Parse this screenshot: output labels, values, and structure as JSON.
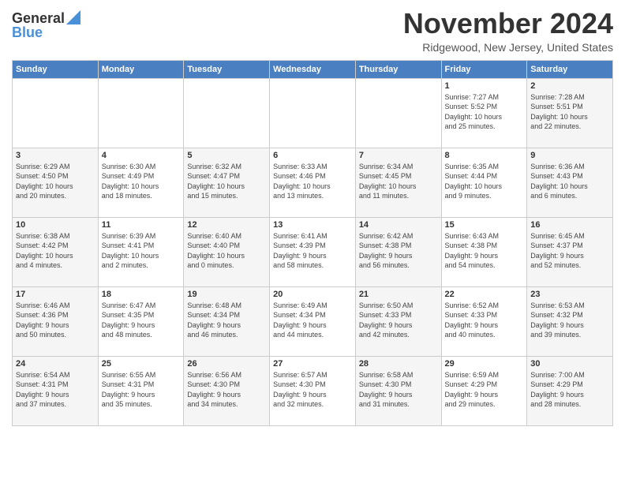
{
  "header": {
    "logo": {
      "line1": "General",
      "line2": "Blue"
    },
    "title": "November 2024",
    "subtitle": "Ridgewood, New Jersey, United States"
  },
  "weekdays": [
    "Sunday",
    "Monday",
    "Tuesday",
    "Wednesday",
    "Thursday",
    "Friday",
    "Saturday"
  ],
  "weeks": [
    [
      {
        "day": "",
        "info": ""
      },
      {
        "day": "",
        "info": ""
      },
      {
        "day": "",
        "info": ""
      },
      {
        "day": "",
        "info": ""
      },
      {
        "day": "",
        "info": ""
      },
      {
        "day": "1",
        "info": "Sunrise: 7:27 AM\nSunset: 5:52 PM\nDaylight: 10 hours\nand 25 minutes."
      },
      {
        "day": "2",
        "info": "Sunrise: 7:28 AM\nSunset: 5:51 PM\nDaylight: 10 hours\nand 22 minutes."
      }
    ],
    [
      {
        "day": "3",
        "info": "Sunrise: 6:29 AM\nSunset: 4:50 PM\nDaylight: 10 hours\nand 20 minutes."
      },
      {
        "day": "4",
        "info": "Sunrise: 6:30 AM\nSunset: 4:49 PM\nDaylight: 10 hours\nand 18 minutes."
      },
      {
        "day": "5",
        "info": "Sunrise: 6:32 AM\nSunset: 4:47 PM\nDaylight: 10 hours\nand 15 minutes."
      },
      {
        "day": "6",
        "info": "Sunrise: 6:33 AM\nSunset: 4:46 PM\nDaylight: 10 hours\nand 13 minutes."
      },
      {
        "day": "7",
        "info": "Sunrise: 6:34 AM\nSunset: 4:45 PM\nDaylight: 10 hours\nand 11 minutes."
      },
      {
        "day": "8",
        "info": "Sunrise: 6:35 AM\nSunset: 4:44 PM\nDaylight: 10 hours\nand 9 minutes."
      },
      {
        "day": "9",
        "info": "Sunrise: 6:36 AM\nSunset: 4:43 PM\nDaylight: 10 hours\nand 6 minutes."
      }
    ],
    [
      {
        "day": "10",
        "info": "Sunrise: 6:38 AM\nSunset: 4:42 PM\nDaylight: 10 hours\nand 4 minutes."
      },
      {
        "day": "11",
        "info": "Sunrise: 6:39 AM\nSunset: 4:41 PM\nDaylight: 10 hours\nand 2 minutes."
      },
      {
        "day": "12",
        "info": "Sunrise: 6:40 AM\nSunset: 4:40 PM\nDaylight: 10 hours\nand 0 minutes."
      },
      {
        "day": "13",
        "info": "Sunrise: 6:41 AM\nSunset: 4:39 PM\nDaylight: 9 hours\nand 58 minutes."
      },
      {
        "day": "14",
        "info": "Sunrise: 6:42 AM\nSunset: 4:38 PM\nDaylight: 9 hours\nand 56 minutes."
      },
      {
        "day": "15",
        "info": "Sunrise: 6:43 AM\nSunset: 4:38 PM\nDaylight: 9 hours\nand 54 minutes."
      },
      {
        "day": "16",
        "info": "Sunrise: 6:45 AM\nSunset: 4:37 PM\nDaylight: 9 hours\nand 52 minutes."
      }
    ],
    [
      {
        "day": "17",
        "info": "Sunrise: 6:46 AM\nSunset: 4:36 PM\nDaylight: 9 hours\nand 50 minutes."
      },
      {
        "day": "18",
        "info": "Sunrise: 6:47 AM\nSunset: 4:35 PM\nDaylight: 9 hours\nand 48 minutes."
      },
      {
        "day": "19",
        "info": "Sunrise: 6:48 AM\nSunset: 4:34 PM\nDaylight: 9 hours\nand 46 minutes."
      },
      {
        "day": "20",
        "info": "Sunrise: 6:49 AM\nSunset: 4:34 PM\nDaylight: 9 hours\nand 44 minutes."
      },
      {
        "day": "21",
        "info": "Sunrise: 6:50 AM\nSunset: 4:33 PM\nDaylight: 9 hours\nand 42 minutes."
      },
      {
        "day": "22",
        "info": "Sunrise: 6:52 AM\nSunset: 4:33 PM\nDaylight: 9 hours\nand 40 minutes."
      },
      {
        "day": "23",
        "info": "Sunrise: 6:53 AM\nSunset: 4:32 PM\nDaylight: 9 hours\nand 39 minutes."
      }
    ],
    [
      {
        "day": "24",
        "info": "Sunrise: 6:54 AM\nSunset: 4:31 PM\nDaylight: 9 hours\nand 37 minutes."
      },
      {
        "day": "25",
        "info": "Sunrise: 6:55 AM\nSunset: 4:31 PM\nDaylight: 9 hours\nand 35 minutes."
      },
      {
        "day": "26",
        "info": "Sunrise: 6:56 AM\nSunset: 4:30 PM\nDaylight: 9 hours\nand 34 minutes."
      },
      {
        "day": "27",
        "info": "Sunrise: 6:57 AM\nSunset: 4:30 PM\nDaylight: 9 hours\nand 32 minutes."
      },
      {
        "day": "28",
        "info": "Sunrise: 6:58 AM\nSunset: 4:30 PM\nDaylight: 9 hours\nand 31 minutes."
      },
      {
        "day": "29",
        "info": "Sunrise: 6:59 AM\nSunset: 4:29 PM\nDaylight: 9 hours\nand 29 minutes."
      },
      {
        "day": "30",
        "info": "Sunrise: 7:00 AM\nSunset: 4:29 PM\nDaylight: 9 hours\nand 28 minutes."
      }
    ]
  ]
}
